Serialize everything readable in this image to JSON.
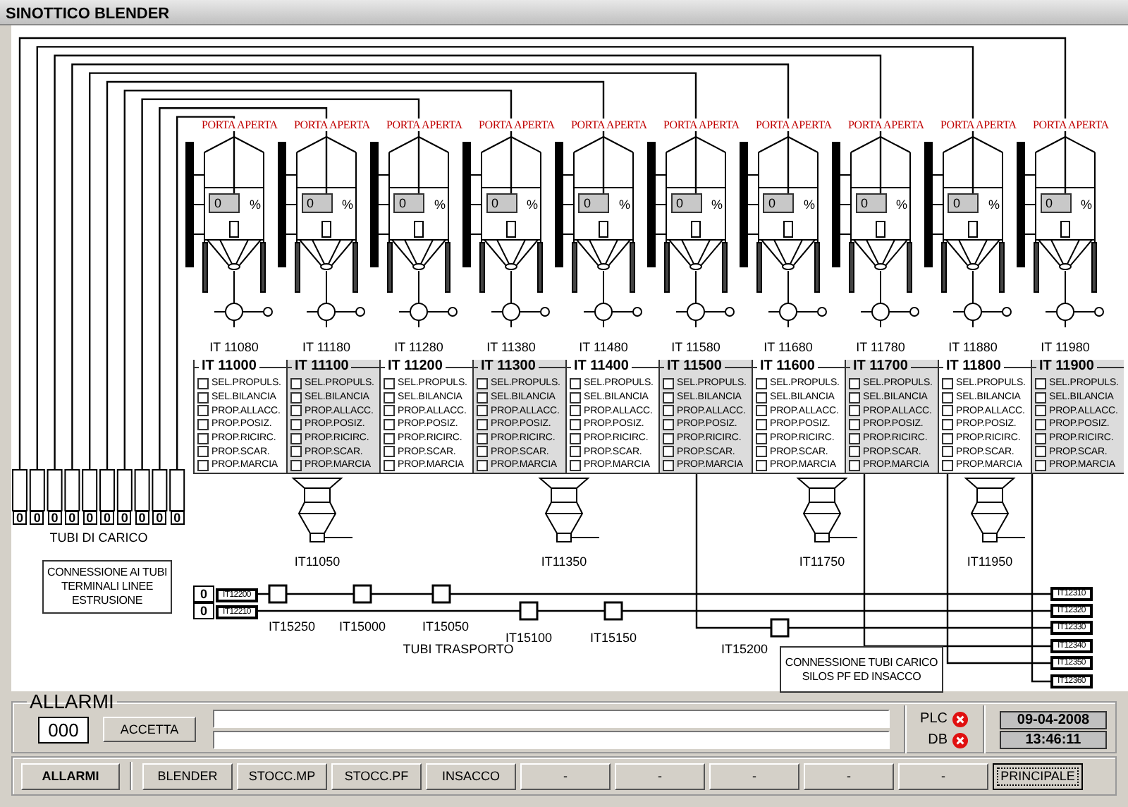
{
  "window": {
    "title": "SINOTTICO BLENDER"
  },
  "silos": [
    {
      "door_status": "PORTA APERTA",
      "level_reading": "0",
      "unit": "%",
      "instrument": "IT 11080"
    },
    {
      "door_status": "PORTA APERTA",
      "level_reading": "0",
      "unit": "%",
      "instrument": "IT 11180"
    },
    {
      "door_status": "PORTA APERTA",
      "level_reading": "0",
      "unit": "%",
      "instrument": "IT 11280"
    },
    {
      "door_status": "PORTA APERTA",
      "level_reading": "0",
      "unit": "%",
      "instrument": "IT 11380"
    },
    {
      "door_status": "PORTA APERTA",
      "level_reading": "0",
      "unit": "%",
      "instrument": "IT 11480"
    },
    {
      "door_status": "PORTA APERTA",
      "level_reading": "0",
      "unit": "%",
      "instrument": "IT 11580"
    },
    {
      "door_status": "PORTA APERTA",
      "level_reading": "0",
      "unit": "%",
      "instrument": "IT 11680"
    },
    {
      "door_status": "PORTA APERTA",
      "level_reading": "0",
      "unit": "%",
      "instrument": "IT 11780"
    },
    {
      "door_status": "PORTA APERTA",
      "level_reading": "0",
      "unit": "%",
      "instrument": "IT 11880"
    },
    {
      "door_status": "PORTA APERTA",
      "level_reading": "0",
      "unit": "%",
      "instrument": "IT 11980"
    }
  ],
  "silo_panels": [
    {
      "title": "IT 11000",
      "shaded": false,
      "options": [
        {
          "label": "SEL.PROPULS.",
          "checked": false
        },
        {
          "label": "SEL.BILANCIA",
          "checked": false
        },
        {
          "label": "PROP.ALLACC.",
          "checked": false
        },
        {
          "label": "PROP.POSIZ.",
          "checked": false
        },
        {
          "label": "PROP.RICIRC.",
          "checked": false
        },
        {
          "label": "PROP.SCAR.",
          "checked": false
        },
        {
          "label": "PROP.MARCIA",
          "checked": false
        }
      ]
    },
    {
      "title": "IT 11100",
      "shaded": true,
      "options": [
        {
          "label": "SEL.PROPULS.",
          "checked": false
        },
        {
          "label": "SEL.BILANCIA",
          "checked": false
        },
        {
          "label": "PROP.ALLACC.",
          "checked": false
        },
        {
          "label": "PROP.POSIZ.",
          "checked": false
        },
        {
          "label": "PROP.RICIRC.",
          "checked": false
        },
        {
          "label": "PROP.SCAR.",
          "checked": false
        },
        {
          "label": "PROP.MARCIA",
          "checked": false
        }
      ]
    },
    {
      "title": "IT 11200",
      "shaded": false,
      "options": [
        {
          "label": "SEL.PROPULS.",
          "checked": false
        },
        {
          "label": "SEL.BILANCIA",
          "checked": false
        },
        {
          "label": "PROP.ALLACC.",
          "checked": false
        },
        {
          "label": "PROP.POSIZ.",
          "checked": false
        },
        {
          "label": "PROP.RICIRC.",
          "checked": false
        },
        {
          "label": "PROP.SCAR.",
          "checked": false
        },
        {
          "label": "PROP.MARCIA",
          "checked": false
        }
      ]
    },
    {
      "title": "IT 11300",
      "shaded": true,
      "options": [
        {
          "label": "SEL.PROPULS.",
          "checked": false
        },
        {
          "label": "SEL.BILANCIA",
          "checked": false
        },
        {
          "label": "PROP.ALLACC.",
          "checked": false
        },
        {
          "label": "PROP.POSIZ.",
          "checked": false
        },
        {
          "label": "PROP.RICIRC.",
          "checked": false
        },
        {
          "label": "PROP.SCAR.",
          "checked": false
        },
        {
          "label": "PROP.MARCIA",
          "checked": false
        }
      ]
    },
    {
      "title": "IT 11400",
      "shaded": false,
      "options": [
        {
          "label": "SEL.PROPULS.",
          "checked": false
        },
        {
          "label": "SEL.BILANCIA",
          "checked": false
        },
        {
          "label": "PROP.ALLACC.",
          "checked": false
        },
        {
          "label": "PROP.POSIZ.",
          "checked": false
        },
        {
          "label": "PROP.RICIRC.",
          "checked": false
        },
        {
          "label": "PROP.SCAR.",
          "checked": false
        },
        {
          "label": "PROP.MARCIA",
          "checked": false
        }
      ]
    },
    {
      "title": "IT 11500",
      "shaded": true,
      "options": [
        {
          "label": "SEL.PROPULS.",
          "checked": false
        },
        {
          "label": "SEL.BILANCIA",
          "checked": false
        },
        {
          "label": "PROP.ALLACC.",
          "checked": false
        },
        {
          "label": "PROP.POSIZ.",
          "checked": false
        },
        {
          "label": "PROP.RICIRC.",
          "checked": false
        },
        {
          "label": "PROP.SCAR.",
          "checked": false
        },
        {
          "label": "PROP.MARCIA",
          "checked": false
        }
      ]
    },
    {
      "title": "IT 11600",
      "shaded": false,
      "options": [
        {
          "label": "SEL.PROPULS.",
          "checked": false
        },
        {
          "label": "SEL.BILANCIA",
          "checked": false
        },
        {
          "label": "PROP.ALLACC.",
          "checked": false
        },
        {
          "label": "PROP.POSIZ.",
          "checked": false
        },
        {
          "label": "PROP.RICIRC.",
          "checked": false
        },
        {
          "label": "PROP.SCAR.",
          "checked": false
        },
        {
          "label": "PROP.MARCIA",
          "checked": false
        }
      ]
    },
    {
      "title": "IT 11700",
      "shaded": true,
      "options": [
        {
          "label": "SEL.PROPULS.",
          "checked": false
        },
        {
          "label": "SEL.BILANCIA",
          "checked": false
        },
        {
          "label": "PROP.ALLACC.",
          "checked": false
        },
        {
          "label": "PROP.POSIZ.",
          "checked": false
        },
        {
          "label": "PROP.RICIRC.",
          "checked": false
        },
        {
          "label": "PROP.SCAR.",
          "checked": false
        },
        {
          "label": "PROP.MARCIA",
          "checked": false
        }
      ]
    },
    {
      "title": "IT 11800",
      "shaded": false,
      "options": [
        {
          "label": "SEL.PROPULS.",
          "checked": false
        },
        {
          "label": "SEL.BILANCIA",
          "checked": false
        },
        {
          "label": "PROP.ALLACC.",
          "checked": false
        },
        {
          "label": "PROP.POSIZ.",
          "checked": false
        },
        {
          "label": "PROP.RICIRC.",
          "checked": false
        },
        {
          "label": "PROP.SCAR.",
          "checked": false
        },
        {
          "label": "PROP.MARCIA",
          "checked": false
        }
      ]
    },
    {
      "title": "IT 11900",
      "shaded": true,
      "options": [
        {
          "label": "SEL.PROPULS.",
          "checked": false
        },
        {
          "label": "SEL.BILANCIA",
          "checked": false
        },
        {
          "label": "PROP.ALLACC.",
          "checked": false
        },
        {
          "label": "PROP.POSIZ.",
          "checked": false
        },
        {
          "label": "PROP.RICIRC.",
          "checked": false
        },
        {
          "label": "PROP.SCAR.",
          "checked": false
        },
        {
          "label": "PROP.MARCIA",
          "checked": false
        }
      ]
    }
  ],
  "loading_tubes": {
    "values": [
      "0",
      "0",
      "0",
      "0",
      "0",
      "0",
      "0",
      "0",
      "0",
      "0"
    ],
    "label": "TUBI DI CARICO"
  },
  "extrusion_note": "CONNESSIONE AI TUBI TERMINALI LINEE ESTRUSIONE",
  "hoppers": [
    "IT11050",
    "IT11350",
    "IT11750",
    "IT11950"
  ],
  "transport": {
    "inputs": [
      {
        "value": "0",
        "tag": "IT12200"
      },
      {
        "value": "0",
        "tag": "IT12210"
      }
    ],
    "valves": [
      "IT15250",
      "IT15000",
      "IT15050",
      "IT15100",
      "IT15150",
      "IT15200"
    ],
    "label": "TUBI TRASPORTO",
    "outputs": [
      "IT12310",
      "IT12320",
      "IT12330",
      "IT12340",
      "IT12350",
      "IT12360"
    ],
    "note": "CONNESSIONE TUBI CARICO SILOS PF ED INSACCO"
  },
  "alarms": {
    "title": "ALLARMI",
    "count": "000",
    "accept_button": "ACCETTA",
    "indicators": [
      {
        "label": "PLC",
        "ok": false
      },
      {
        "label": "DB",
        "ok": false
      }
    ],
    "date": "09-04-2008",
    "time": "13:46:11"
  },
  "nav": [
    {
      "label": "ALLARMI",
      "kind": "alarms",
      "selected": false
    },
    {
      "label": "BLENDER",
      "kind": "page",
      "selected": false
    },
    {
      "label": "STOCC.MP",
      "kind": "page",
      "selected": false
    },
    {
      "label": "STOCC.PF",
      "kind": "page",
      "selected": false
    },
    {
      "label": "INSACCO",
      "kind": "page",
      "selected": false
    },
    {
      "label": "-",
      "kind": "page",
      "selected": false
    },
    {
      "label": "-",
      "kind": "page",
      "selected": false
    },
    {
      "label": "-",
      "kind": "page",
      "selected": false
    },
    {
      "label": "-",
      "kind": "page",
      "selected": false
    },
    {
      "label": "-",
      "kind": "page",
      "selected": false
    },
    {
      "label": "PRINCIPALE",
      "kind": "page",
      "selected": true
    }
  ]
}
